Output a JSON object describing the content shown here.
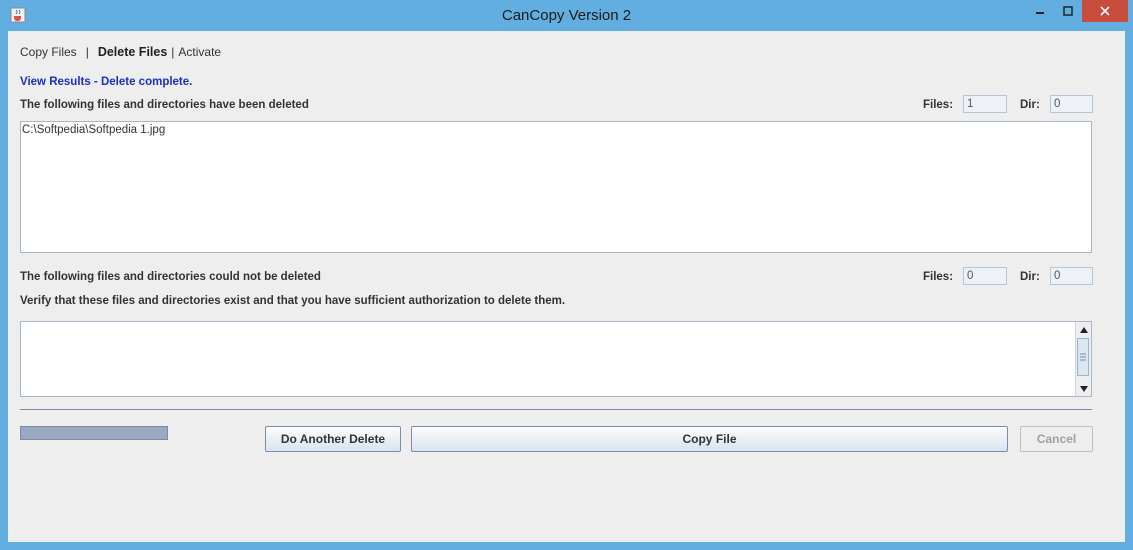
{
  "window": {
    "title": "CanCopy Version 2"
  },
  "icons": {
    "app": "java-cup-icon",
    "minimize": "minimize-icon",
    "maximize": "maximize-icon",
    "close": "close-icon"
  },
  "nav": {
    "copy_files": "Copy Files",
    "sep1": "|",
    "delete_files": "Delete Files",
    "sep2": "|",
    "activate": "Activate"
  },
  "status": "View Results - Delete complete.",
  "deleted": {
    "label": "The following files and directories have been deleted",
    "files_label": "Files:",
    "files_value": "1",
    "dir_label": "Dir:",
    "dir_value": "0",
    "items": [
      "C:\\Softpedia\\Softpedia 1.jpg"
    ]
  },
  "not_deleted": {
    "label": "The following files and directories could not be deleted",
    "files_label": "Files:",
    "files_value": "0",
    "dir_label": "Dir:",
    "dir_value": "0",
    "verify": "Verify that these files and directories exist and that you have sufficient authorization to delete them.",
    "items": []
  },
  "buttons": {
    "another_delete": "Do Another Delete",
    "copy_file": "Copy File",
    "cancel": "Cancel"
  },
  "colors": {
    "accent": "#1b2fc4",
    "titlebar": "#62aee0",
    "close": "#c74c3c"
  }
}
